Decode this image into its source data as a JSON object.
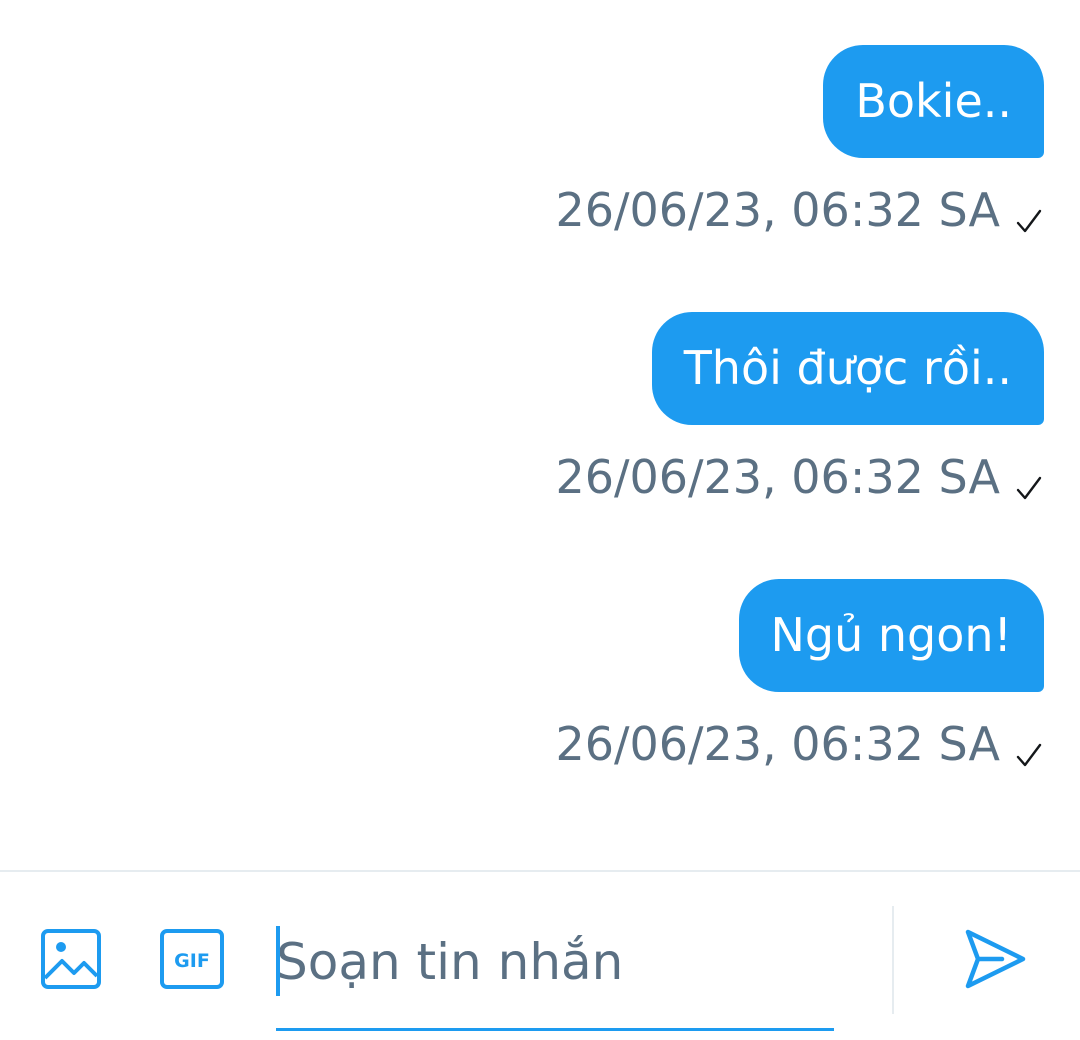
{
  "messages": [
    {
      "text": "Bokie..",
      "timestamp": "26/06/23, 06:32 SA",
      "status_icon": "check-icon"
    },
    {
      "text": "Thôi được rồi..",
      "timestamp": "26/06/23, 06:32 SA",
      "status_icon": "check-icon"
    },
    {
      "text": "Ngủ ngon!",
      "timestamp": "26/06/23, 06:32 SA",
      "status_icon": "check-icon"
    }
  ],
  "composer": {
    "image_icon": "image-icon",
    "gif_icon": "gif-icon",
    "gif_label": "GIF",
    "placeholder": "Soạn tin nhắn",
    "value": "",
    "send_icon": "send-icon"
  },
  "colors": {
    "accent": "#1d9bf0",
    "bubble_text": "#ffffff",
    "meta_text": "#5b7083",
    "divider": "#e6ecf0"
  }
}
